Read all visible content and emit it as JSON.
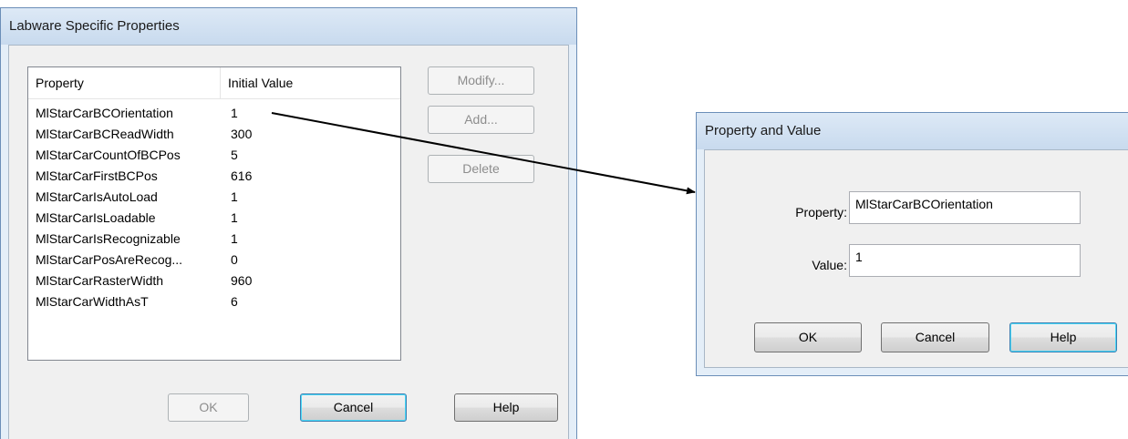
{
  "labware_dialog": {
    "title": "Labware Specific Properties",
    "columns": [
      "Property",
      "Initial Value"
    ],
    "rows": [
      {
        "property": "MlStarCarBCOrientation",
        "value": "1"
      },
      {
        "property": "MlStarCarBCReadWidth",
        "value": "300"
      },
      {
        "property": "MlStarCarCountOfBCPos",
        "value": "5"
      },
      {
        "property": "MlStarCarFirstBCPos",
        "value": "616"
      },
      {
        "property": "MlStarCarIsAutoLoad",
        "value": "1"
      },
      {
        "property": "MlStarCarIsLoadable",
        "value": "1"
      },
      {
        "property": "MlStarCarIsRecognizable",
        "value": "1"
      },
      {
        "property": "MlStarCarPosAreRecog...",
        "value": "0"
      },
      {
        "property": "MlStarCarRasterWidth",
        "value": "960"
      },
      {
        "property": "MlStarCarWidthAsT",
        "value": "6"
      }
    ],
    "buttons": {
      "modify": "Modify...",
      "add": "Add...",
      "delete": "Delete",
      "ok": "OK",
      "cancel": "Cancel",
      "help": "Help"
    }
  },
  "property_dialog": {
    "title": "Property and Value",
    "property_label": "Property:",
    "property_value": "MlStarCarBCOrientation",
    "value_label": "Value:",
    "value_value": "1",
    "buttons": {
      "ok": "OK",
      "cancel": "Cancel",
      "help": "Help"
    }
  }
}
